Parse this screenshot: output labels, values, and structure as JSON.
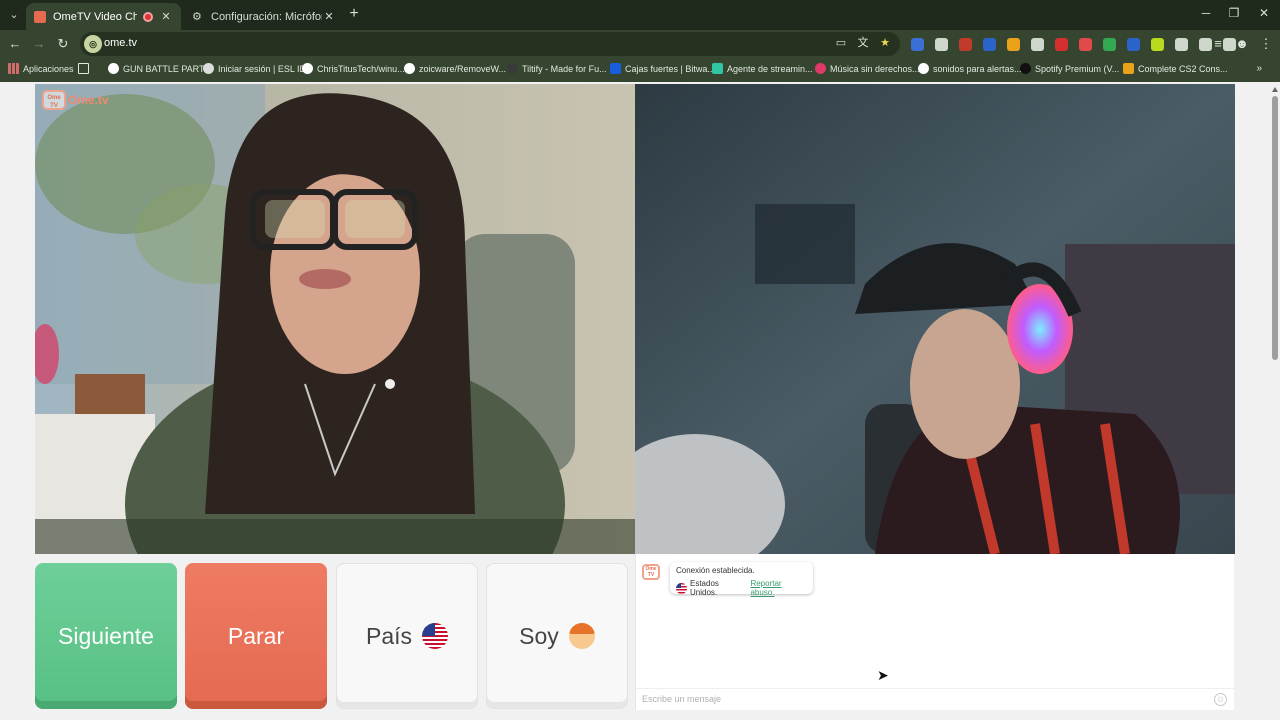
{
  "browser": {
    "tabs": [
      {
        "title": "OmeTV Video Chat — Ome",
        "active": true,
        "favicon_color": "#e46a51",
        "recording": true
      },
      {
        "title": "Configuración: Micrófono",
        "active": false,
        "favicon_color": "#9aa39a",
        "recording": false
      }
    ],
    "new_tab_label": "+",
    "url": "ome.tv",
    "window_controls": [
      "─",
      "❐",
      "✕"
    ],
    "bookmarks": [
      {
        "label": "Aplicaciones",
        "icon": "apps-grid-icon",
        "color": "#d36b6b"
      },
      {
        "label": "GUN BATTLE PARTY",
        "icon": "globe-icon",
        "color": "#ffffff"
      },
      {
        "label": "Iniciar sesión | ESL ID",
        "icon": "esl-icon",
        "color": "#dddddd"
      },
      {
        "label": "ChrisTitusTech/winu...",
        "icon": "github-icon",
        "color": "#ffffff"
      },
      {
        "label": "zoicware/RemoveW...",
        "icon": "github-icon",
        "color": "#ffffff"
      },
      {
        "label": "Tiltify - Made for Fu...",
        "icon": "tiltify-icon",
        "color": "#3a3a3a"
      },
      {
        "label": "Cajas fuertes | Bitwa...",
        "icon": "bitwarden-icon",
        "color": "#175ddc"
      },
      {
        "label": "Agente de streamin...",
        "icon": "streaming-icon",
        "color": "#2fc6a4"
      },
      {
        "label": "Música sin derechos...",
        "icon": "music-icon",
        "color": "#e03a6a"
      },
      {
        "label": "sonidos para alertas...",
        "icon": "google-icon",
        "color": "#ffffff"
      },
      {
        "label": "Spotify Premium (V...",
        "icon": "spotify-icon",
        "color": "#111111"
      },
      {
        "label": "Complete CS2 Cons...",
        "icon": "cs2-icon",
        "color": "#e9a21a"
      }
    ],
    "extension_colors": [
      "#3b6fd6",
      "#cfd6cc",
      "#c23a2a",
      "#2b63c9",
      "#e9a21a",
      "#cfd6cc",
      "#d53030",
      "#e04a4a",
      "#34a853",
      "#2b63c9",
      "#bada1f",
      "#cfd6cc",
      "#cfd6cc",
      "#cfd6cc"
    ]
  },
  "site": {
    "logo_small": "Ome TV",
    "logo_text": "Ome.tv"
  },
  "controls": {
    "next_label": "Siguiente",
    "stop_label": "Parar",
    "country_label": "País",
    "country_flag": "us-flag-icon",
    "gender_label": "Soy",
    "gender_emoji": "boy-emoji-icon"
  },
  "chat": {
    "status": "Conexión establecida.",
    "country": "Estados Unidos.",
    "report_link": "Reportar abuso.",
    "input_placeholder": "Escribe un mensaje"
  },
  "colors": {
    "next": "#5cc48a",
    "stop": "#e76e55",
    "accent_link": "#3a9a6e"
  }
}
